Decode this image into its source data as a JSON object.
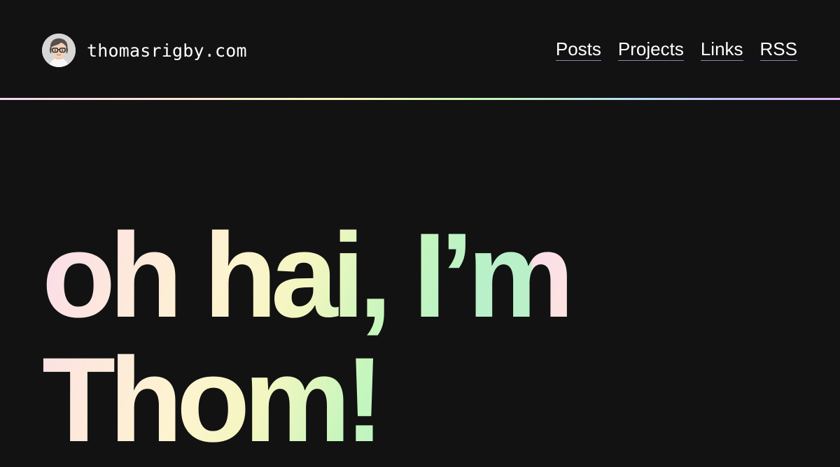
{
  "header": {
    "site_name": "thomasrigby.com",
    "avatar_alt": "Thomas Rigby avatar",
    "nav": [
      {
        "label": "Posts"
      },
      {
        "label": "Projects"
      },
      {
        "label": "Links"
      },
      {
        "label": "RSS"
      }
    ]
  },
  "hero": {
    "line_1": "oh hai, I’m",
    "line_2": "Thom!"
  },
  "colors": {
    "background": "#121212",
    "text": "#ffffff",
    "link_underline": "#8a86b8",
    "gradient_pink": "#fadbea",
    "gradient_yellow": "#fdf4cf",
    "gradient_green": "#c4f6bd",
    "gradient_blue": "#b6e0f0",
    "gradient_purple": "#e2b3f4"
  }
}
